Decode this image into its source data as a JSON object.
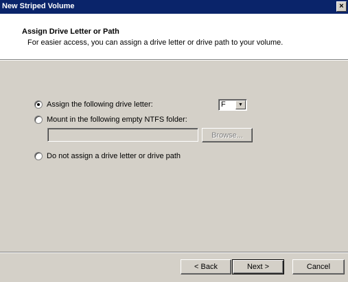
{
  "window": {
    "title": "New Striped Volume",
    "close_label": "×"
  },
  "header": {
    "title": "Assign Drive Letter or Path",
    "subtitle": "For easier access, you can assign a drive letter or drive path to your volume."
  },
  "options": {
    "assign_letter": {
      "label": "Assign the following drive letter:",
      "selected": true
    },
    "mount_folder": {
      "label": "Mount in the following empty NTFS folder:",
      "selected": false
    },
    "no_assign": {
      "label": "Do not assign a drive letter or drive path",
      "selected": false
    }
  },
  "drive_letter": {
    "value": "F",
    "arrow": "▼"
  },
  "folder_input": {
    "value": ""
  },
  "buttons": {
    "browse": "Browse...",
    "back": "< Back",
    "next": "Next >",
    "cancel": "Cancel"
  }
}
